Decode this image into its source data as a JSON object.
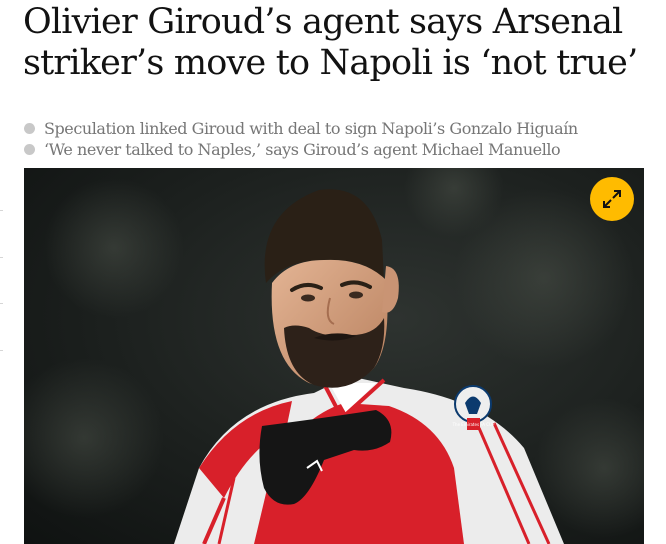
{
  "article": {
    "headline": "Olivier Giroud’s agent says Arsenal striker’s move to Napoli is ‘not true’",
    "standfirst": [
      "Speculation linked Giroud with deal to sign Napoli’s Gonzalo Higuaín",
      "‘We never talked to Naples,’ says Giroud’s agent Michael Manuello"
    ]
  },
  "media": {
    "expand_icon": "expand-arrows-icon",
    "expand_button_color": "#ffbb00",
    "photo_badge_text": "The Emirates FA CUP"
  },
  "colors": {
    "headline": "#121212",
    "standfirst": "#767676",
    "bullet": "#c8c8c8",
    "shirt_red": "#d8202a"
  }
}
